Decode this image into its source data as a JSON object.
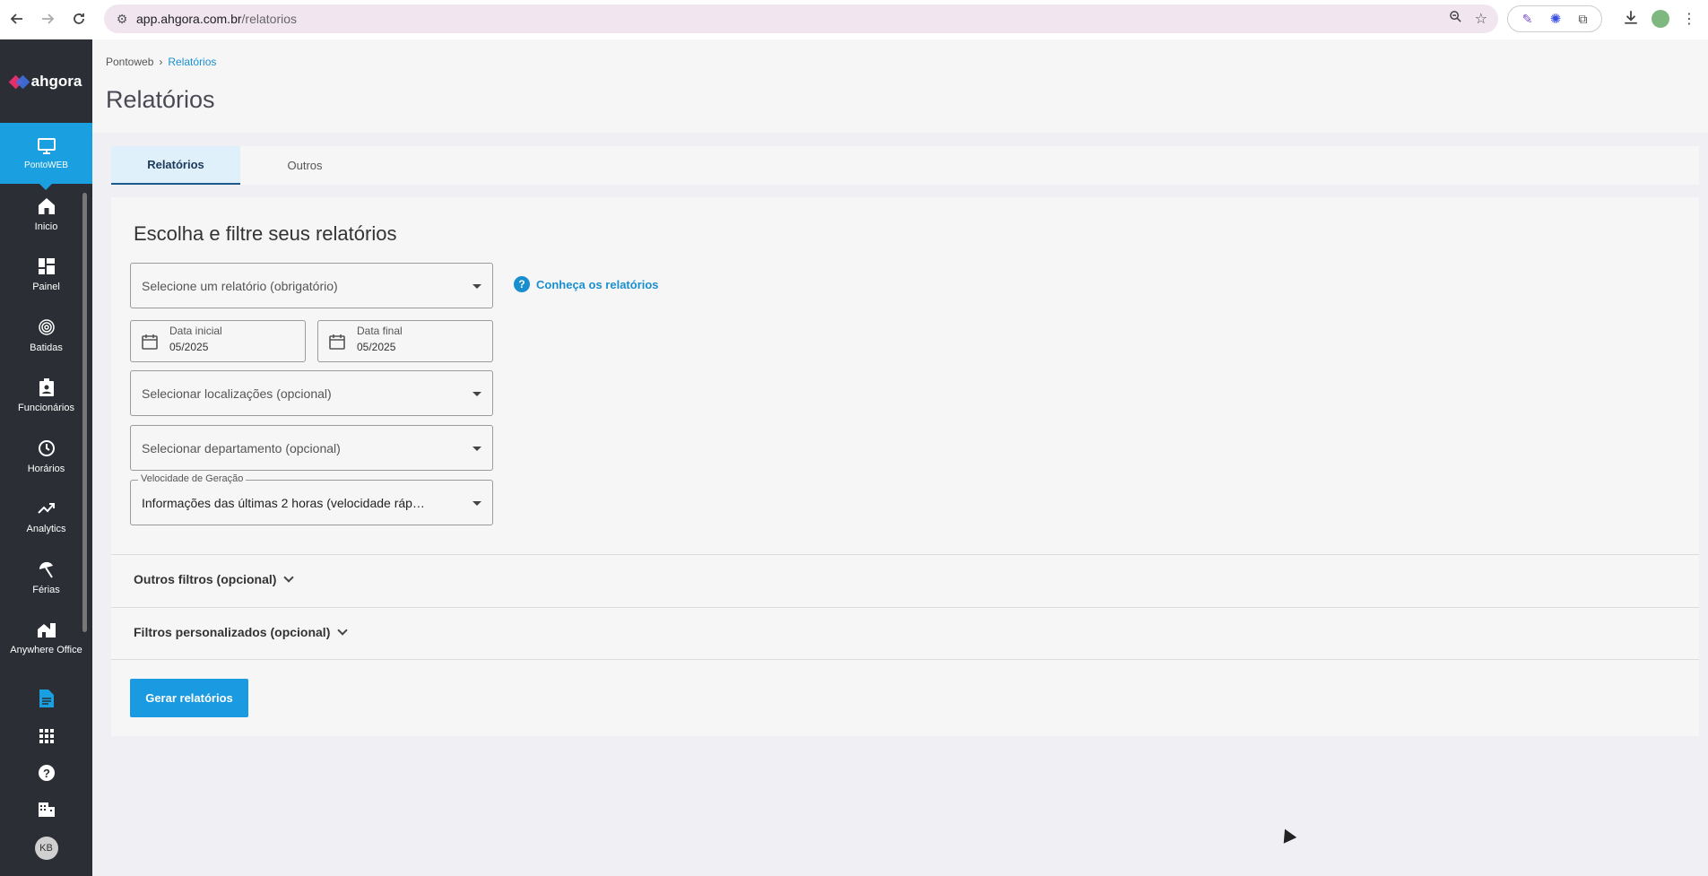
{
  "browser": {
    "url_host": "app.ahgora.com.br",
    "url_path": "/relatorios"
  },
  "sidebar": {
    "logo_text": "ahgora",
    "active_module": "PontoWEB",
    "items": [
      {
        "label": "Inicio",
        "icon": "home-icon"
      },
      {
        "label": "Painel",
        "icon": "dashboard-icon"
      },
      {
        "label": "Batidas",
        "icon": "fingerprint-icon"
      },
      {
        "label": "Funcionários",
        "icon": "badge-icon"
      },
      {
        "label": "Horários",
        "icon": "clock-icon"
      },
      {
        "label": "Analytics",
        "icon": "trending-up-icon"
      },
      {
        "label": "Férias",
        "icon": "beach-umbrella-icon"
      },
      {
        "label": "Anywhere Office",
        "icon": "home-work-icon"
      },
      {
        "label": "",
        "icon": "document-icon"
      }
    ],
    "avatar_initials": "KB"
  },
  "breadcrumb": {
    "root": "Pontoweb",
    "current": "Relatórios"
  },
  "page": {
    "title": "Relatórios"
  },
  "tabs": [
    {
      "label": "Relatórios",
      "active": true
    },
    {
      "label": "Outros",
      "active": false
    }
  ],
  "form": {
    "title": "Escolha e filtre seus relatórios",
    "report_select_placeholder": "Selecione um relatório (obrigatório)",
    "help_link": "Conheça os relatórios",
    "start_date_label": "Data inicial",
    "start_date_value": "05/2025",
    "end_date_label": "Data final",
    "end_date_value": "05/2025",
    "locations_placeholder": "Selecionar localizações (opcional)",
    "department_placeholder": "Selecionar departamento (opcional)",
    "speed_label": "Velocidade de Geração",
    "speed_value": "Informações das últimas 2 horas (velocidade ráp…",
    "other_filters": "Outros filtros (opcional)",
    "custom_filters": "Filtros personalizados (opcional)",
    "submit": "Gerar relatórios"
  },
  "colors": {
    "accent": "#1a9ae0",
    "sidebar_bg": "#2b2f35",
    "tab_active_bg": "#dff0fa"
  }
}
